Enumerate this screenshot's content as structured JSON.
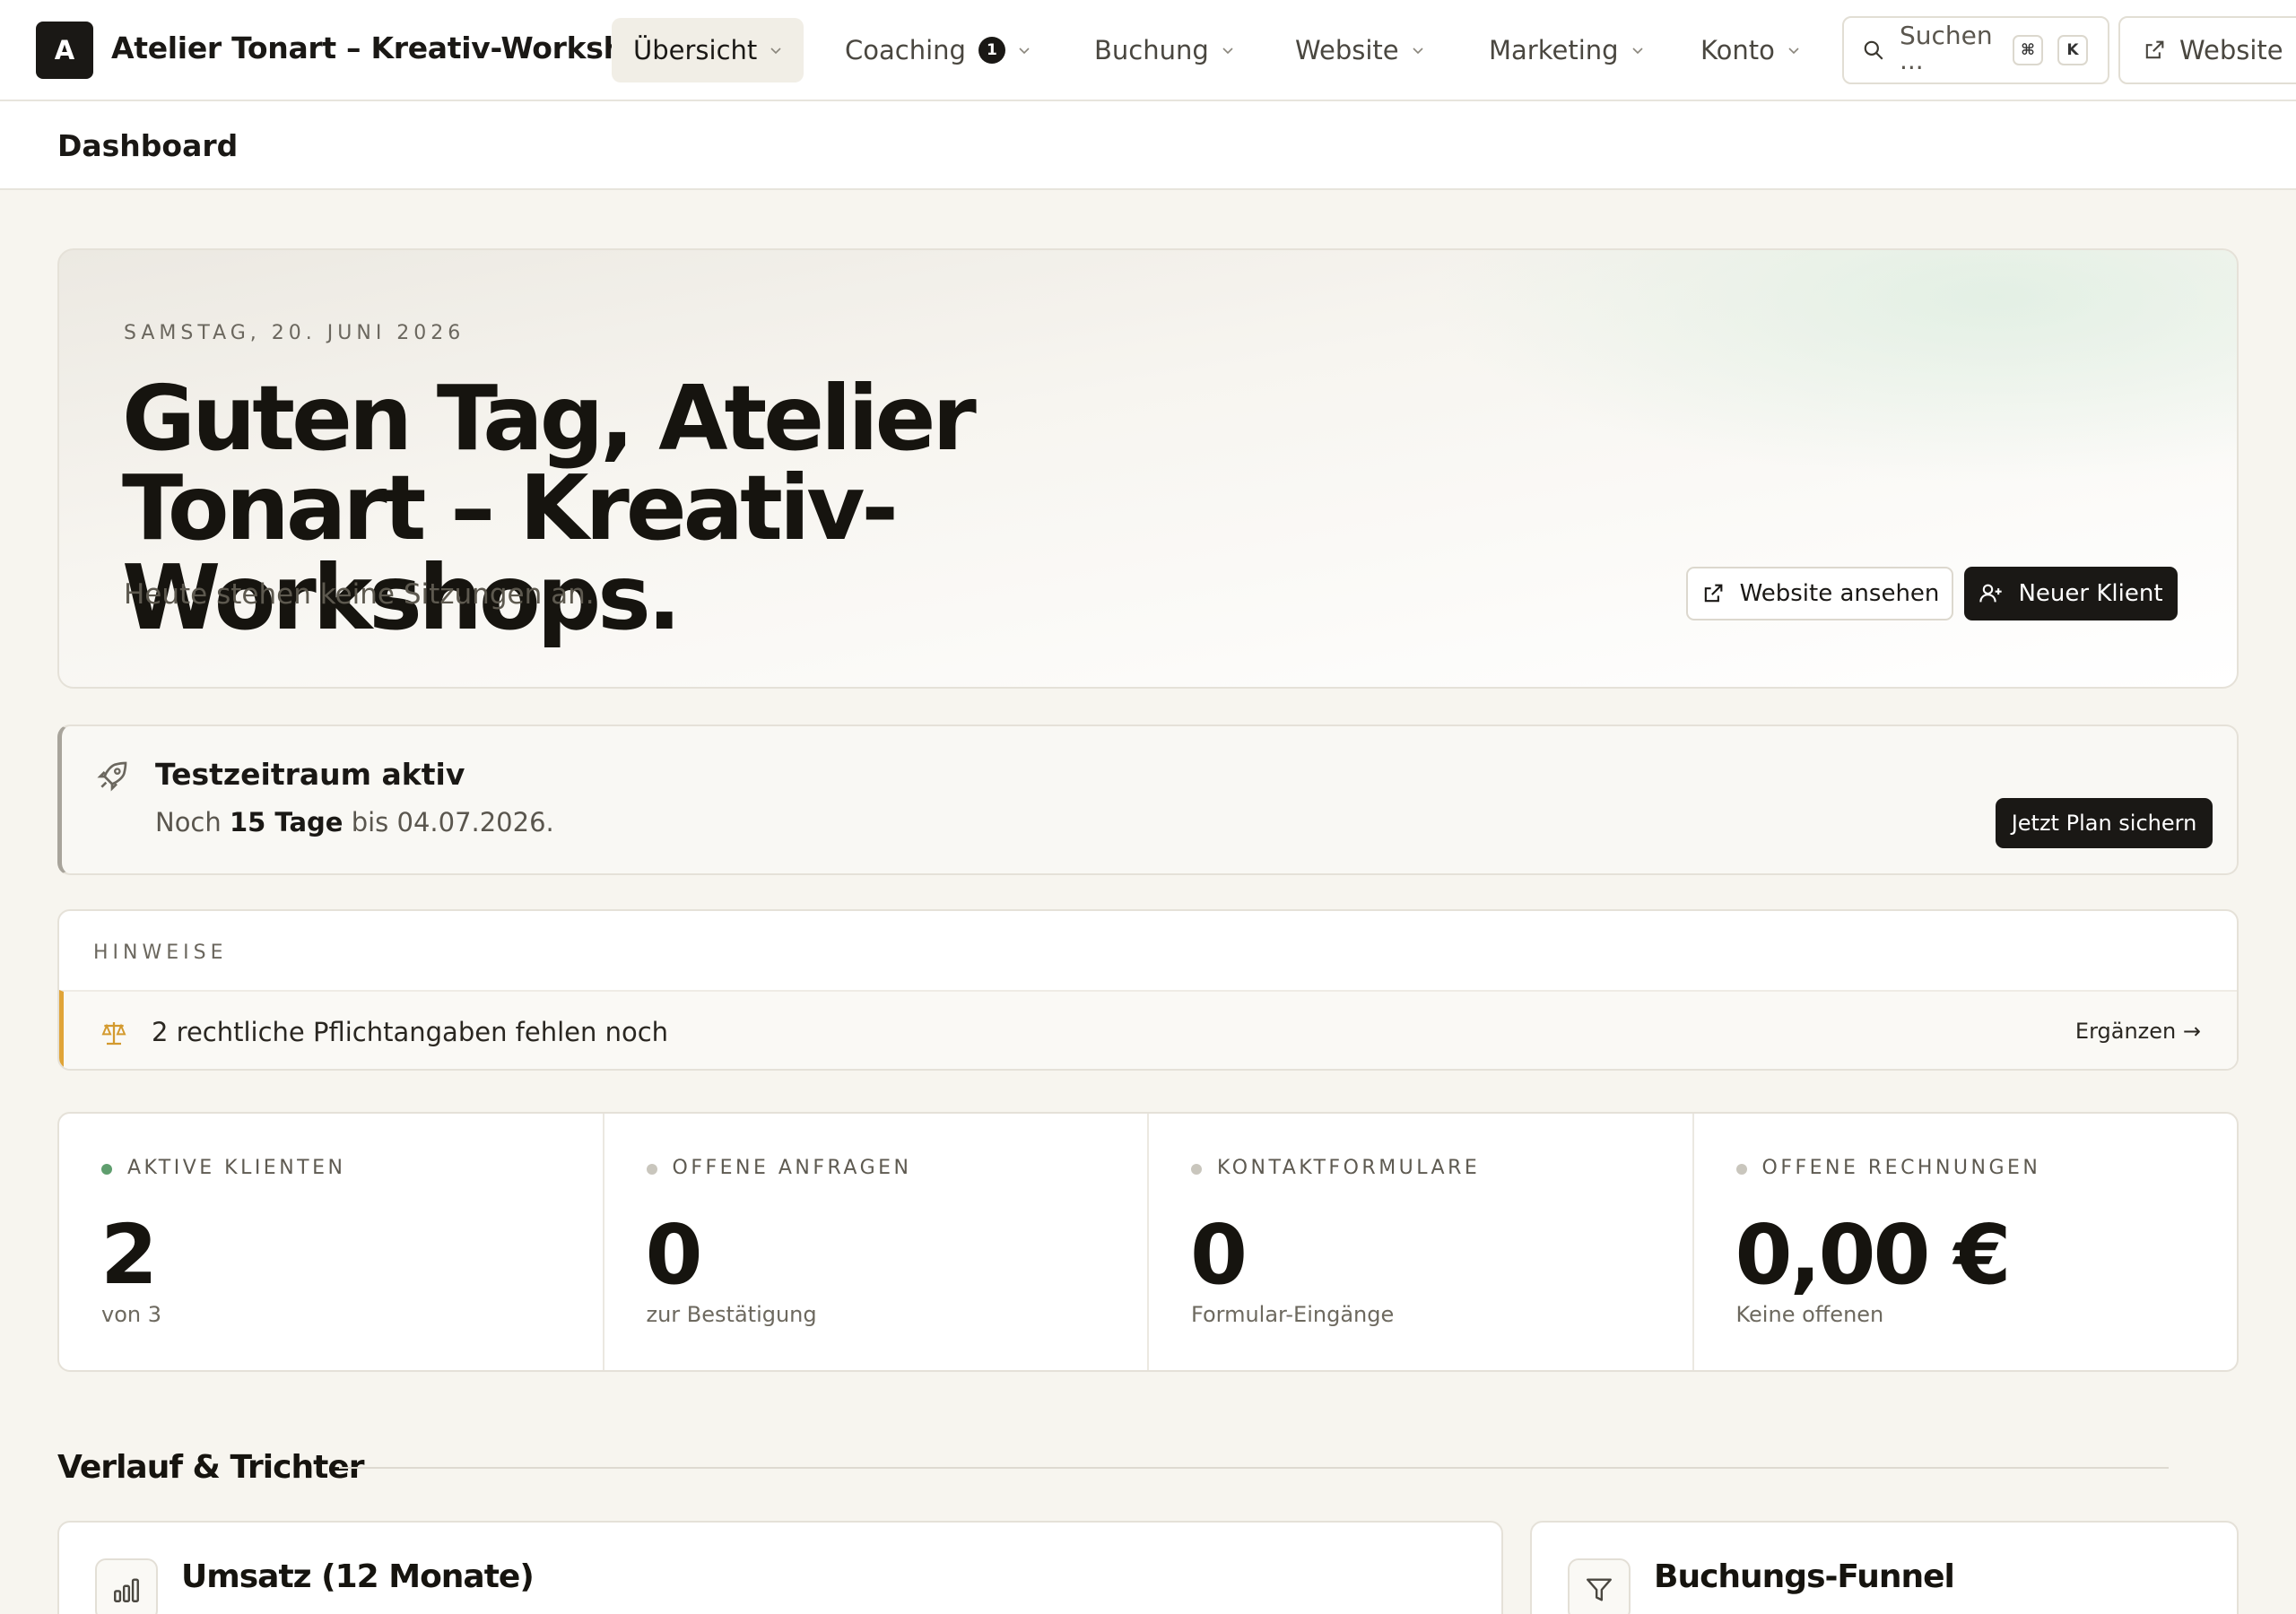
{
  "nav": {
    "brand_initial": "A",
    "brand_name": "Atelier Tonart – Kreativ-Workshops",
    "items": [
      {
        "label": "Übersicht"
      },
      {
        "label": "Coaching",
        "badge": "1"
      },
      {
        "label": "Buchung"
      },
      {
        "label": "Website"
      },
      {
        "label": "Marketing"
      },
      {
        "label": "Konto"
      }
    ],
    "search_label": "Suchen ...",
    "search_kbd_1": "⌘",
    "search_kbd_2": "K",
    "website_link": "Website"
  },
  "breadcrumb": "Dashboard",
  "hero": {
    "date": "SAMSTAG, 20. JUNI 2026",
    "title": "Guten Tag, Atelier Tonart – Kreativ-Workshops.",
    "subtitle": "Heute stehen keine Sitzungen an.",
    "btn_view_website": "Website ansehen",
    "btn_new_client": "Neuer Klient"
  },
  "trial": {
    "title": "Testzeitraum aktiv",
    "text_prefix": "Noch",
    "days": "15 Tage",
    "text_suffix": "bis 04.07.2026.",
    "cta": "Jetzt Plan sichern"
  },
  "hints": {
    "label": "HINWEISE",
    "items": [
      {
        "text": "2 rechtliche Pflichtangaben fehlen noch",
        "action": "Ergänzen →"
      }
    ]
  },
  "stats": [
    {
      "label": "AKTIVE KLIENTEN",
      "value": "2",
      "sub": "von 3",
      "status": "green"
    },
    {
      "label": "OFFENE ANFRAGEN",
      "value": "0",
      "sub": "zur Bestätigung",
      "status": "gray"
    },
    {
      "label": "KONTAKTFORMULARE",
      "value": "0",
      "sub": "Formular-Eingänge",
      "status": "gray"
    },
    {
      "label": "OFFENE RECHNUNGEN",
      "value": "0,00 €",
      "sub": "Keine offenen",
      "status": "gray"
    }
  ],
  "section": {
    "title": "Verlauf & Trichter",
    "cards": [
      {
        "title": "Umsatz (12 Monate)",
        "icon": "bar-chart-icon"
      },
      {
        "title": "Buchungs-Funnel",
        "icon": "funnel-icon"
      }
    ]
  },
  "colors": {
    "accent_dark": "#1a1815",
    "hint_accent": "#e0a437",
    "status_green": "#5f9e6e"
  }
}
